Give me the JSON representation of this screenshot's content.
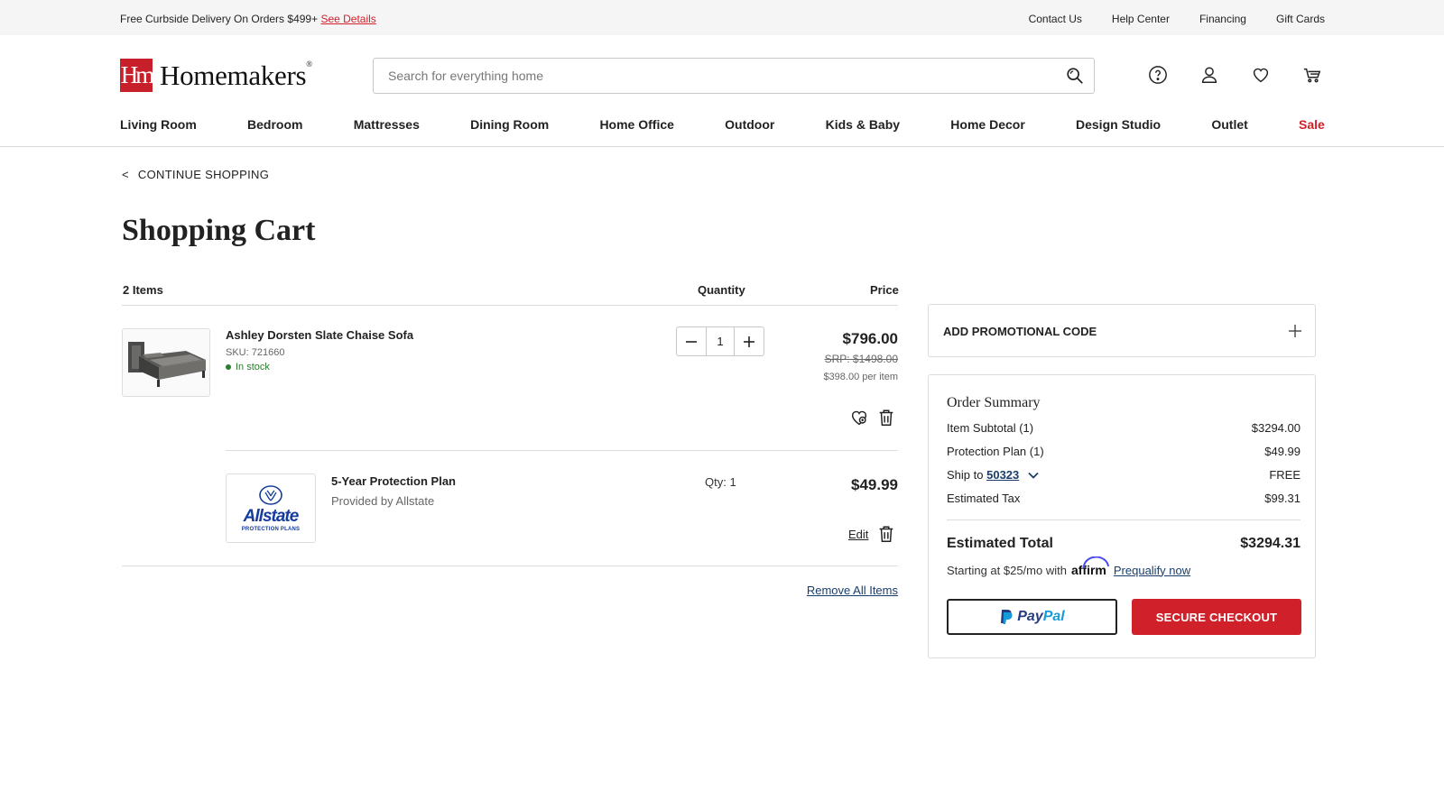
{
  "topbar": {
    "promo_text": "Free Curbside Delivery On Orders $499+",
    "promo_link": "See Details",
    "links": [
      "Contact Us",
      "Help Center",
      "Financing",
      "Gift Cards"
    ]
  },
  "header": {
    "logo_mark": "Hm",
    "logo_text": "Homemakers",
    "logo_reg": "®",
    "search_placeholder": "Search for everything home",
    "icons": [
      "help-icon",
      "account-icon",
      "wishlist-heart-icon",
      "cart-icon"
    ]
  },
  "nav": {
    "items": [
      "Living Room",
      "Bedroom",
      "Mattresses",
      "Dining Room",
      "Home Office",
      "Outdoor",
      "Kids & Baby",
      "Home Decor",
      "Design Studio",
      "Outlet",
      "Sale"
    ]
  },
  "cart": {
    "continue_label": "CONTINUE SHOPPING",
    "title": "Shopping Cart",
    "items_count": "2 Items",
    "col_quantity": "Quantity",
    "col_price": "Price",
    "product": {
      "name": "Ashley Dorsten Slate Chaise Sofa",
      "sku": "SKU: 721660",
      "stock": "In stock",
      "quantity": "1",
      "price": "$796.00",
      "srp": "SRP: $1498.00",
      "per_item": "$398.00 per item"
    },
    "plan": {
      "logo_brand": "Allstate",
      "logo_sub": "PROTECTION PLANS",
      "name": "5-Year Protection Plan",
      "provider": "Provided by Allstate",
      "qty": "Qty: 1",
      "price": "$49.99",
      "edit_label": "Edit"
    },
    "remove_all": "Remove All Items"
  },
  "promo": {
    "label": "ADD PROMOTIONAL CODE"
  },
  "summary": {
    "title": "Order Summary",
    "rows": [
      {
        "label": "Item Subtotal (1)",
        "value": "$3294.00"
      },
      {
        "label": "Protection Plan (1)",
        "value": "$49.99"
      },
      {
        "label": "Ship to",
        "zip": "50323",
        "value": "FREE"
      },
      {
        "label": "Estimated Tax",
        "value": "$99.31"
      }
    ],
    "total_label": "Estimated Total",
    "total_value": "$3294.31",
    "finance_text": "Starting at $25/mo with",
    "affirm": "affirm",
    "prequalify": "Prequalify now",
    "paypal_pay": "Pay",
    "paypal_pal": "Pal",
    "checkout": "SECURE CHECKOUT"
  },
  "colors": {
    "brand_red": "#d0212a",
    "link_blue": "#1a3d6b",
    "stock_green": "#2a7d2e"
  }
}
